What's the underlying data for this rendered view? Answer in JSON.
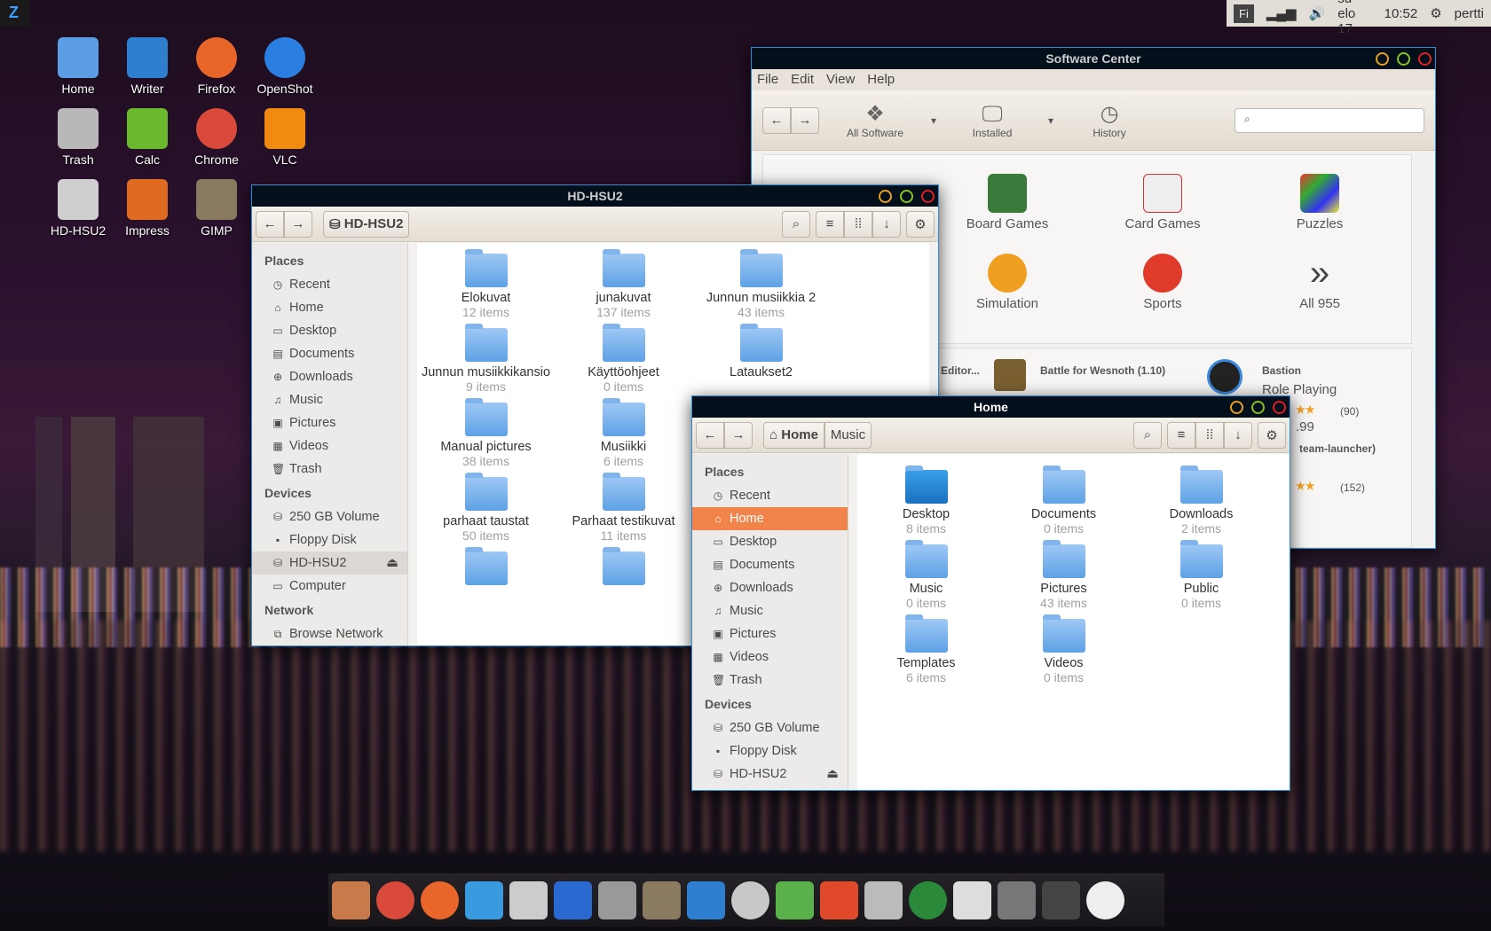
{
  "top_panel": {
    "keyboard": "Fi",
    "date": "su elo 17",
    "time": "10:52",
    "user": "pertti",
    "icons": [
      "signal-icon",
      "volume-icon",
      "gear-icon"
    ]
  },
  "launcher": {
    "icon": "zorin-logo-icon"
  },
  "desktop_icons": [
    {
      "label": "Home",
      "color": "#5c9ee6"
    },
    {
      "label": "Writer",
      "color": "#2e7fd0"
    },
    {
      "label": "Firefox",
      "color": "#e8662a"
    },
    {
      "label": "OpenShot",
      "color": "#2a7fe0"
    },
    {
      "label": "Trash",
      "color": "#b8b8b8"
    },
    {
      "label": "Calc",
      "color": "#6ab82e"
    },
    {
      "label": "Chrome",
      "color": "#d94a3a"
    },
    {
      "label": "VLC",
      "color": "#f08a10"
    },
    {
      "label": "HD-HSU2",
      "color": "#cfcfcf"
    },
    {
      "label": "Impress",
      "color": "#e06a20"
    },
    {
      "label": "GIMP",
      "color": "#8a7a60"
    }
  ],
  "software_center": {
    "title": "Software Center",
    "menu": [
      "File",
      "Edit",
      "View",
      "Help"
    ],
    "toolbar": {
      "all_software": "All Software",
      "installed": "Installed",
      "history": "History",
      "search_placeholder": ""
    },
    "categories": [
      "Board Games",
      "Card Games",
      "Puzzles",
      "Simulation",
      "Sports",
      "All 955"
    ],
    "list": {
      "partial": "Editor...",
      "wesnoth": "Battle for Wesnoth (1.10)",
      "bastion": "Bastion",
      "bastion_genre": "Role Playing",
      "bastion_reviews": "(90)",
      "bastion_price": ".99",
      "steam": "team-launcher)",
      "steam_reviews": "(152)"
    }
  },
  "hd_window": {
    "title": "HD-HSU2",
    "path": "HD-HSU2",
    "sidebar": {
      "places_header": "Places",
      "places": [
        "Recent",
        "Home",
        "Desktop",
        "Documents",
        "Downloads",
        "Music",
        "Pictures",
        "Videos",
        "Trash"
      ],
      "devices_header": "Devices",
      "devices": [
        "250 GB Volume",
        "Floppy Disk",
        "HD-HSU2",
        "Computer"
      ],
      "network_header": "Network",
      "network": [
        "Browse Network"
      ]
    },
    "items": [
      {
        "name": "Elokuvat",
        "count": "12 items"
      },
      {
        "name": "junakuvat",
        "count": "137 items"
      },
      {
        "name": "Junnun musiikkia 2",
        "count": "43 items"
      },
      {
        "name": "Junnun musiikkikansio",
        "count": "9 items"
      },
      {
        "name": "Käyttöohjeet",
        "count": "0 items"
      },
      {
        "name": "Lataukset2",
        "count": ""
      },
      {
        "name": "Manual pictures",
        "count": "38 items"
      },
      {
        "name": "Musiikki",
        "count": "6 items"
      },
      {
        "name": "",
        "count": ""
      },
      {
        "name": "parhaat taustat",
        "count": "50 items"
      },
      {
        "name": "Parhaat testikuvat",
        "count": "11 items"
      },
      {
        "name": "",
        "count": ""
      },
      {
        "name": "",
        "count": ""
      },
      {
        "name": "",
        "count": ""
      }
    ]
  },
  "home_window": {
    "title": "Home",
    "path": [
      "Home",
      "Music"
    ],
    "sidebar": {
      "places_header": "Places",
      "places": [
        "Recent",
        "Home",
        "Desktop",
        "Documents",
        "Downloads",
        "Music",
        "Pictures",
        "Videos",
        "Trash"
      ],
      "selected": "Home",
      "devices_header": "Devices",
      "devices": [
        "250 GB Volume",
        "Floppy Disk",
        "HD-HSU2"
      ]
    },
    "items": [
      {
        "name": "Desktop",
        "count": "8 items"
      },
      {
        "name": "Documents",
        "count": "0 items"
      },
      {
        "name": "Downloads",
        "count": "2 items"
      },
      {
        "name": "Music",
        "count": "0 items"
      },
      {
        "name": "Pictures",
        "count": "43 items"
      },
      {
        "name": "Public",
        "count": "0 items"
      },
      {
        "name": "Templates",
        "count": "6 items"
      },
      {
        "name": "Videos",
        "count": "0 items"
      }
    ]
  },
  "dock": [
    {
      "name": "anchor",
      "color": "#c87a4a"
    },
    {
      "name": "chrome",
      "color": "#d94a3a"
    },
    {
      "name": "firefox",
      "color": "#e8662a"
    },
    {
      "name": "software-center",
      "color": "#3a9ae0"
    },
    {
      "name": "scanner",
      "color": "#ccc"
    },
    {
      "name": "monitor",
      "color": "#2a6ad0"
    },
    {
      "name": "calculator",
      "color": "#999"
    },
    {
      "name": "gimp",
      "color": "#8a7a60"
    },
    {
      "name": "writer",
      "color": "#2e7fd0"
    },
    {
      "name": "disc",
      "color": "#c8c8c8"
    },
    {
      "name": "tasks",
      "color": "#5ab04a"
    },
    {
      "name": "tiles",
      "color": "#e04a2a"
    },
    {
      "name": "trash",
      "color": "#bbb"
    },
    {
      "name": "globe",
      "color": "#2a8a3a"
    },
    {
      "name": "drive",
      "color": "#ddd"
    },
    {
      "name": "hourglass",
      "color": "#777"
    },
    {
      "name": "workspaces",
      "color": "#444"
    },
    {
      "name": "clock",
      "color": "#eee"
    }
  ]
}
